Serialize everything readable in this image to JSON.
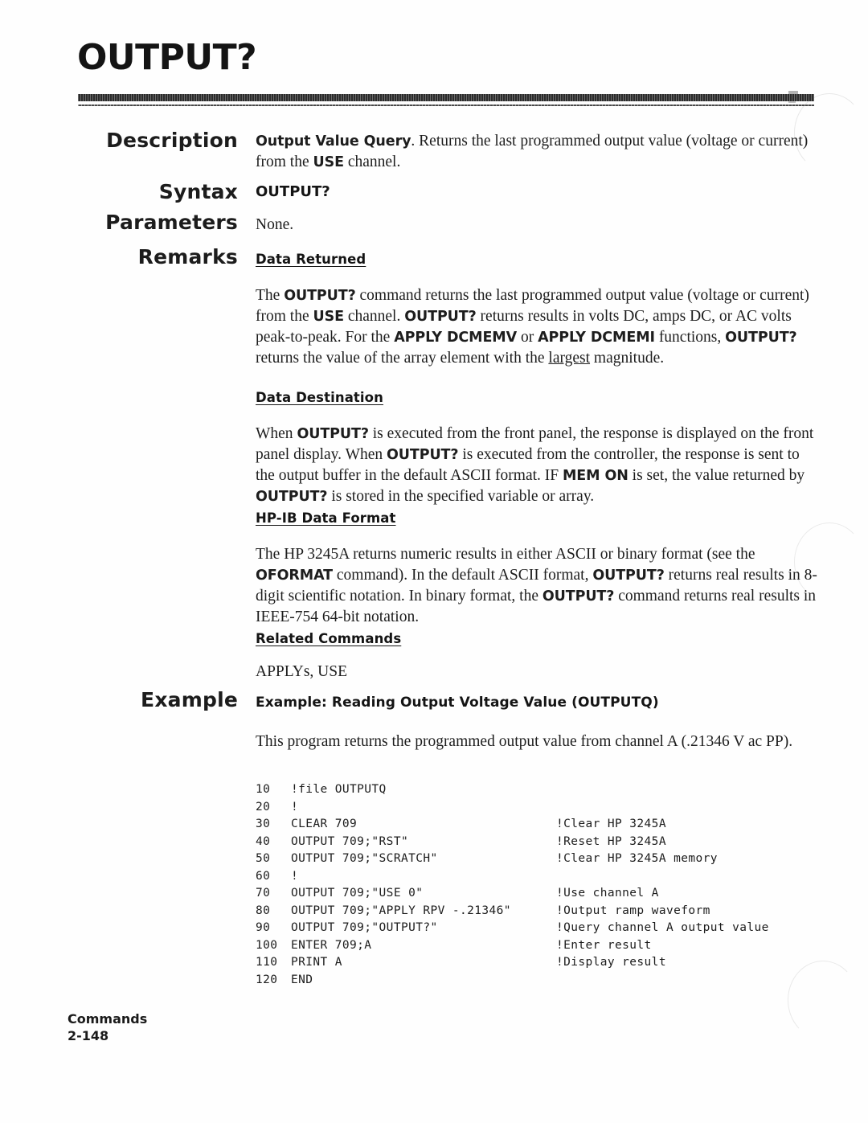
{
  "page": {
    "title": "OUTPUT?",
    "footer_section": "Commands",
    "footer_page": "2-148"
  },
  "labels": {
    "description": "Description",
    "syntax": "Syntax",
    "parameters": "Parameters",
    "remarks": "Remarks",
    "example": "Example"
  },
  "description": {
    "lead": "Output Value Query",
    "text_a": ".  Returns the last programmed output value (voltage or current) from the ",
    "bold_use": "USE",
    "text_b": " channel."
  },
  "syntax": {
    "value": "OUTPUT?"
  },
  "parameters": {
    "value": "None."
  },
  "remarks": {
    "data_returned": {
      "heading": "Data Returned",
      "t1": "The ",
      "b1": "OUTPUT?",
      "t2": " command returns the last programmed output value (voltage or current) from the ",
      "b2": "USE",
      "t3": " channel.  ",
      "b3": "OUTPUT?",
      "t4": " returns results in volts DC, amps DC, or AC volts peak-to-peak.  For the ",
      "b4": "APPLY DCMEMV",
      "t5": " or ",
      "b5": "APPLY DCMEMI",
      "t6": "  functions, ",
      "b6": "OUTPUT?",
      "t7": " returns the value of the array element with the ",
      "u1": "largest",
      "t8": " magnitude."
    },
    "data_destination": {
      "heading": "Data Destination",
      "t1": "When ",
      "b1": "OUTPUT?",
      "t2": " is executed from the front panel, the response is displayed on the front panel display.  When ",
      "b2": "OUTPUT?",
      "t3": " is executed from the controller, the response is sent to the output buffer in the default ASCII format.  IF ",
      "b3": "MEM ON",
      "t4": " is set, the value returned by ",
      "b4": "OUTPUT?",
      "t5": " is stored in the specified variable or array."
    },
    "hpib_data_format": {
      "heading": "HP-IB Data Format",
      "t1": "The HP 3245A returns numeric results in either ASCII or binary format (see the ",
      "b1": "OFORMAT",
      "t2": " command).  In the default ASCII format, ",
      "b2": "OUTPUT?",
      "t3": " returns real results in 8-digit scientific notation.  In binary format, the ",
      "b3": "OUTPUT?",
      "t4": " command returns real results in IEEE-754 64-bit notation."
    },
    "related_commands": {
      "heading": "Related Commands",
      "value": "APPLYs, USE"
    }
  },
  "example": {
    "heading": "Example: Reading Output Voltage Value (OUTPUTQ)",
    "intro": "This program returns the programmed output value from channel A (.21346 V ac PP).",
    "code": [
      {
        "num": "10",
        "src": "!file OUTPUTQ",
        "comment": ""
      },
      {
        "num": "20",
        "src": "!",
        "comment": ""
      },
      {
        "num": "30",
        "src": "CLEAR 709",
        "comment": "!Clear HP 3245A"
      },
      {
        "num": "40",
        "src": "OUTPUT 709;\"RST\"",
        "comment": "!Reset HP 3245A"
      },
      {
        "num": "50",
        "src": "OUTPUT 709;\"SCRATCH\"",
        "comment": "!Clear HP 3245A memory"
      },
      {
        "num": "60",
        "src": "!",
        "comment": ""
      },
      {
        "num": "70",
        "src": "OUTPUT 709;\"USE 0\"",
        "comment": "!Use channel A"
      },
      {
        "num": "80",
        "src": "OUTPUT 709;\"APPLY RPV -.21346\"",
        "comment": "!Output ramp waveform"
      },
      {
        "num": "90",
        "src": "OUTPUT 709;\"OUTPUT?\"",
        "comment": "!Query channel A output value"
      },
      {
        "num": "100",
        "src": "ENTER 709;A",
        "comment": "!Enter result"
      },
      {
        "num": "110",
        "src": "PRINT A",
        "comment": "!Display result"
      },
      {
        "num": "120",
        "src": "END",
        "comment": ""
      }
    ]
  }
}
